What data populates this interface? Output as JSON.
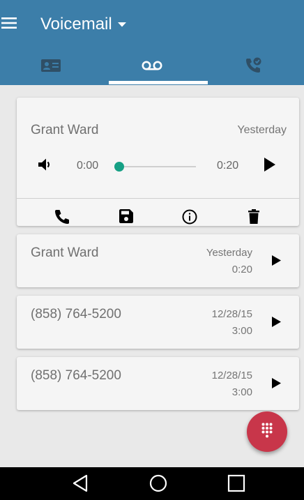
{
  "appbar": {
    "title": "Voicemail",
    "color": "#3c7ea9",
    "menu_icon": "hamburger-menu-icon",
    "dropdown_icon": "caret-down-icon"
  },
  "tabs": [
    {
      "icon": "contact-card-icon",
      "selected": false
    },
    {
      "icon": "voicemail-icon",
      "selected": true
    },
    {
      "icon": "call-history-icon",
      "selected": false
    }
  ],
  "expanded_voicemail": {
    "name": "Grant Ward",
    "date": "Yesterday",
    "current_time": "0:00",
    "duration": "0:20",
    "progress": 0,
    "accent": "#16a085",
    "actions": [
      {
        "icon": "phone-icon"
      },
      {
        "icon": "save-icon"
      },
      {
        "icon": "info-icon"
      },
      {
        "icon": "trash-icon"
      }
    ]
  },
  "voicemails": [
    {
      "name": "Grant Ward",
      "date": "Yesterday",
      "duration": "0:20"
    },
    {
      "name": "(858) 764-5200",
      "date": "12/28/15",
      "duration": "3:00"
    },
    {
      "name": "(858) 764-5200",
      "date": "12/28/15",
      "duration": "3:00"
    }
  ],
  "fab": {
    "icon": "dialpad-icon",
    "color": "#c8364a"
  },
  "navbar": [
    {
      "icon": "back-icon"
    },
    {
      "icon": "home-icon"
    },
    {
      "icon": "recents-icon"
    }
  ]
}
